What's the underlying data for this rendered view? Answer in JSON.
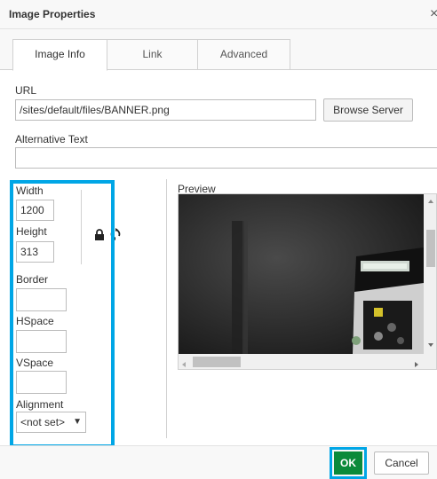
{
  "dialog": {
    "title": "Image Properties",
    "close_glyph": "×"
  },
  "tabs": [
    {
      "label": "Image Info",
      "active": true
    },
    {
      "label": "Link",
      "active": false
    },
    {
      "label": "Advanced",
      "active": false
    }
  ],
  "url": {
    "label": "URL",
    "value": "/sites/default/files/BANNER.png",
    "browse_label": "Browse Server"
  },
  "alt_text": {
    "label": "Alternative Text",
    "value": ""
  },
  "dimensions": {
    "width_label": "Width",
    "width_value": "1200",
    "height_label": "Height",
    "height_value": "313",
    "lock_icon": "lock-icon",
    "reset_icon": "reset-size-icon"
  },
  "border": {
    "label": "Border",
    "value": ""
  },
  "hspace": {
    "label": "HSpace",
    "value": ""
  },
  "vspace": {
    "label": "VSpace",
    "value": ""
  },
  "alignment": {
    "label": "Alignment",
    "selected": "<not set>"
  },
  "preview": {
    "label": "Preview"
  },
  "footer": {
    "ok_label": "OK",
    "cancel_label": "Cancel"
  },
  "colors": {
    "highlight": "#00a6e6",
    "ok_green": "#0b8a3a",
    "border": "#bcbcbc"
  }
}
